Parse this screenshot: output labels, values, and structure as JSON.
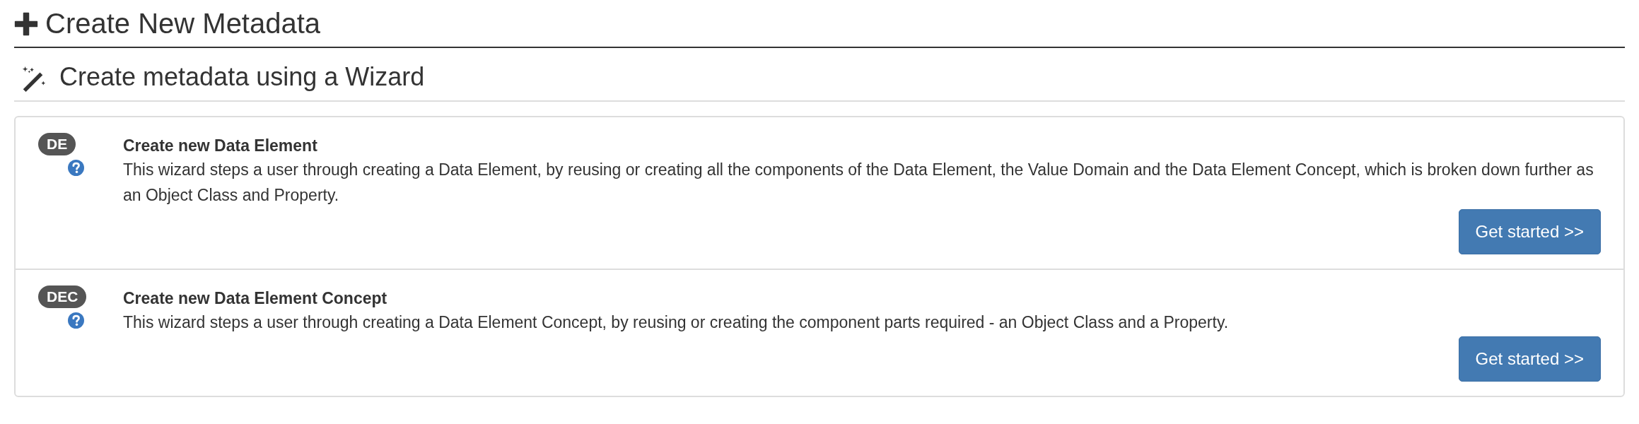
{
  "page_title": "Create New Metadata",
  "section_title": "Create metadata using a Wizard",
  "wizards": [
    {
      "badge": "DE",
      "title": "Create new Data Element",
      "description": "This wizard steps a user through creating a Data Element, by reusing or creating all the components of the Data Element, the Value Domain and the Data Element Concept, which is broken down further as an Object Class and Property.",
      "button": "Get started >>"
    },
    {
      "badge": "DEC",
      "title": "Create new Data Element Concept",
      "description": "This wizard steps a user through creating a Data Element Concept, by reusing or creating the component parts required - an Object Class and a Property.",
      "button": "Get started >>"
    }
  ]
}
